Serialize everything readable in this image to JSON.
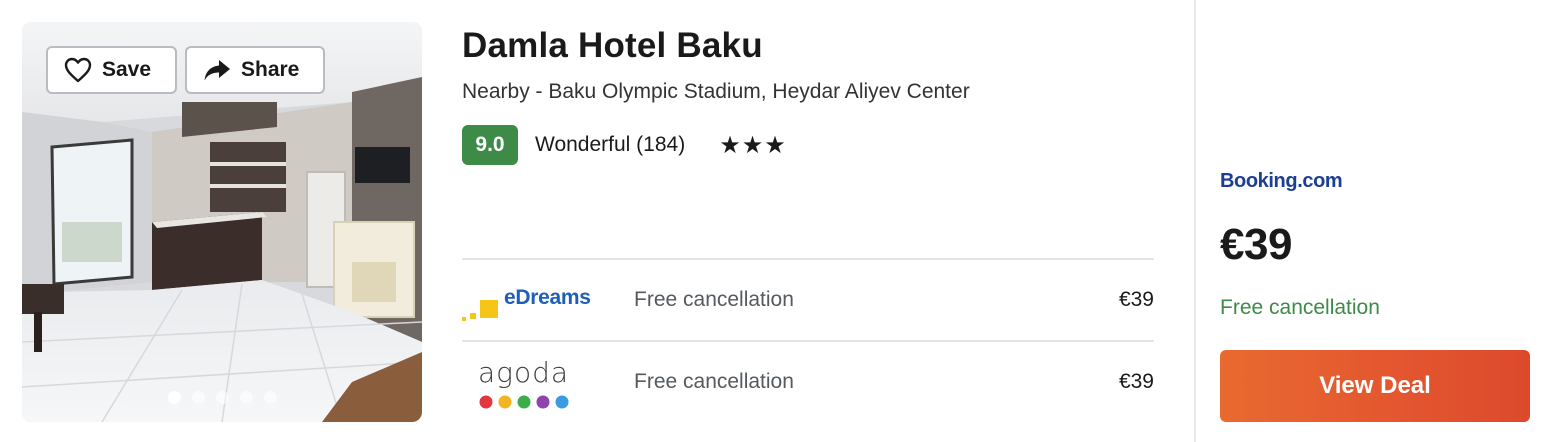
{
  "hotel": {
    "name": "Damla Hotel Baku",
    "nearby": "Nearby - Baku Olympic Stadium, Heydar Aliyev Center",
    "score": "9.0",
    "rating_text": "Wonderful (184)",
    "stars": "★★★",
    "star_count": 3
  },
  "photo": {
    "save_label": "Save",
    "share_label": "Share",
    "slide_count": 5,
    "active_slide": 1
  },
  "providers": [
    {
      "name": "eDreams",
      "logo_icon": "edreams-logo",
      "cancellation": "Free cancellation",
      "price": "€39"
    },
    {
      "name": "agoda",
      "logo_icon": "agoda-logo",
      "cancellation": "Free cancellation",
      "price": "€39"
    }
  ],
  "deal": {
    "provider": "Booking.com",
    "price": "€39",
    "cancellation": "Free cancellation",
    "button_label": "View Deal"
  },
  "colors": {
    "score_green": "#3e8a47",
    "cancel_green": "#3e8a47",
    "cta_orange": "#e3552f",
    "booking_blue": "#1c3f94",
    "edreams_blue": "#1f5fb9"
  }
}
